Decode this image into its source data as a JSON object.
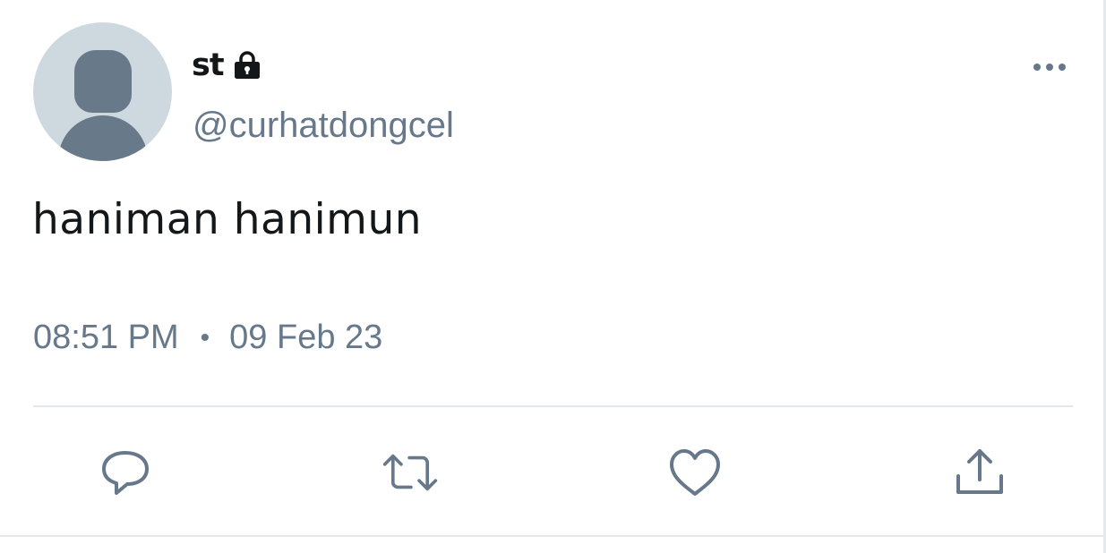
{
  "tweet": {
    "display_name": "st",
    "protected_icon": "lock-icon",
    "handle": "@curhatdongcel",
    "text": "haniman hanimun",
    "time": "08:51 PM",
    "separator": "•",
    "date": "09 Feb 23",
    "more_icon": "more-horizontal-icon"
  },
  "actions": [
    {
      "name": "reply",
      "icon": "reply-icon"
    },
    {
      "name": "retweet",
      "icon": "retweet-icon"
    },
    {
      "name": "like",
      "icon": "heart-icon"
    },
    {
      "name": "share",
      "icon": "share-icon"
    }
  ],
  "colors": {
    "text_primary": "#14171a",
    "text_secondary": "#67788a",
    "avatar_bg": "#ced9df",
    "avatar_fg": "#68798a",
    "divider": "#e1e8ed"
  }
}
